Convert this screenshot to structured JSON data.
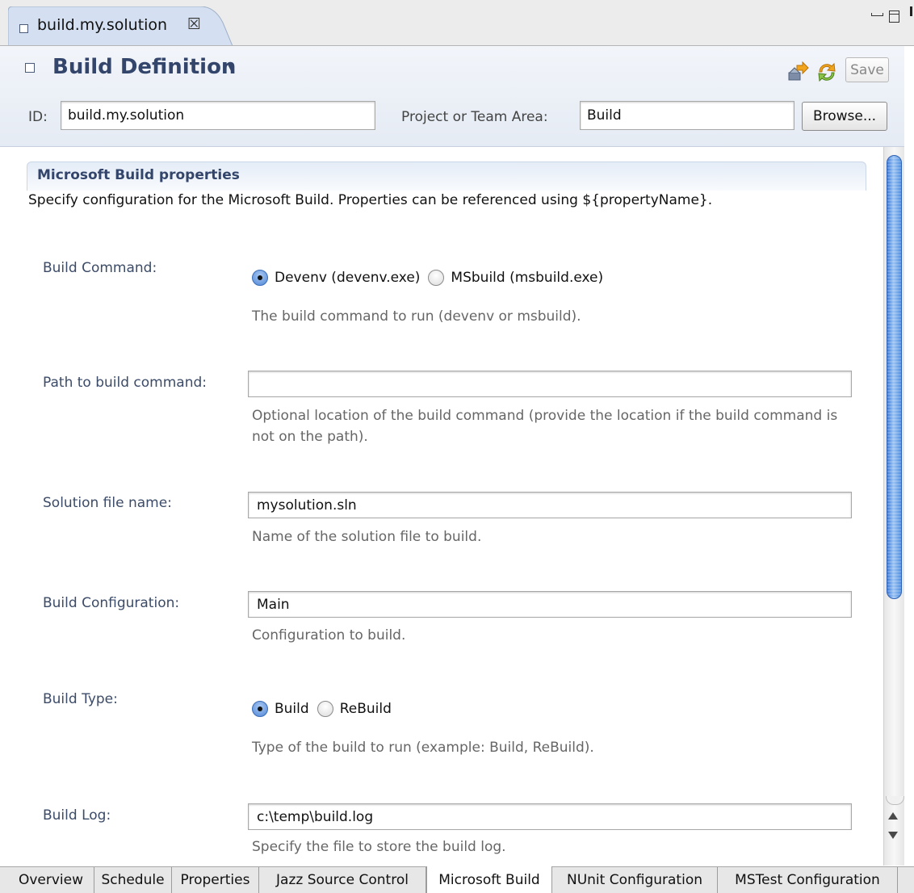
{
  "editor": {
    "tab_title": "build.my.solution",
    "close_glyph": "☒"
  },
  "header": {
    "title": "Build Definition",
    "dropdown_glyph": "▾",
    "save_label": "Save",
    "id_label": "ID:",
    "id_value": "build.my.solution",
    "area_label": "Project or Team Area:",
    "area_value": "Build",
    "browse_label": "Browse..."
  },
  "section": {
    "title": "Microsoft Build properties",
    "description": "Specify configuration for the Microsoft Build. Properties can be referenced using ${propertyName}."
  },
  "fields": {
    "build_command": {
      "label": "Build Command:",
      "options": [
        "Devenv (devenv.exe)",
        "MSbuild (msbuild.exe)"
      ],
      "selected": "Devenv (devenv.exe)",
      "hint": "The build command to run (devenv or msbuild)."
    },
    "path": {
      "label": "Path to build command:",
      "value": "",
      "hint": "Optional location of the build command (provide the location if the build command is not on the path)."
    },
    "solution": {
      "label": "Solution file name:",
      "value": "mysolution.sln",
      "hint": "Name of the solution file to build."
    },
    "configuration": {
      "label": "Build Configuration:",
      "value": "Main",
      "hint": "Configuration to build."
    },
    "build_type": {
      "label": "Build Type:",
      "options": [
        "Build",
        "ReBuild"
      ],
      "selected": "Build",
      "hint": "Type of the build to run (example: Build, ReBuild)."
    },
    "build_log": {
      "label": "Build Log:",
      "value": "c:\\temp\\build.log",
      "hint": "Specify the file to store the build log."
    }
  },
  "page_tabs": [
    "Overview",
    "Schedule",
    "Properties",
    "Jazz Source Control",
    "Microsoft Build",
    "NUnit Configuration",
    "MSTest Configuration"
  ],
  "active_page_tab": "Microsoft Build",
  "icons": {
    "editor_tab": "build-definition-icon",
    "tool1": "build-request-icon",
    "tool2": "refresh-icon",
    "minimize": "minimize-icon",
    "maximize": "maximize-icon"
  },
  "colors": {
    "accent": "#33456b",
    "scroll_thumb": "#4f8ee0",
    "header_bg": "#e5ebf4"
  }
}
